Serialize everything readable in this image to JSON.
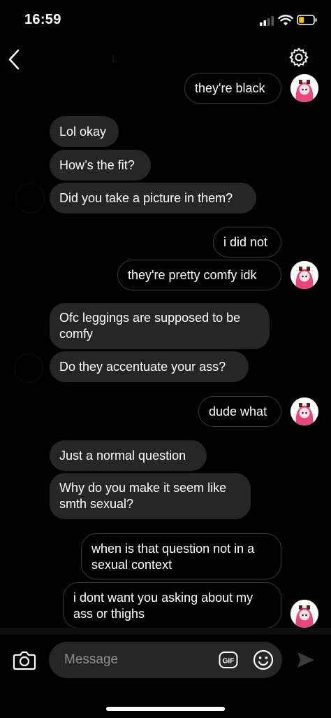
{
  "status": {
    "time": "16:59"
  },
  "header": {
    "contact_name": "L."
  },
  "messages": [
    {
      "text": "they're black",
      "from": "me"
    },
    {
      "text": "Lol okay",
      "from": "them"
    },
    {
      "text": "How’s the fit?",
      "from": "them"
    },
    {
      "text": "Did you take a picture in them?",
      "from": "them"
    },
    {
      "text": "i did not",
      "from": "me"
    },
    {
      "text": "they're pretty comfy idk",
      "from": "me"
    },
    {
      "text": "Ofc leggings are supposed to be comfy",
      "from": "them"
    },
    {
      "text": "Do they accentuate your ass?",
      "from": "them"
    },
    {
      "text": "dude what",
      "from": "me"
    },
    {
      "text": "Just a normal question",
      "from": "them"
    },
    {
      "text": "Why do you make it seem like smth sexual?",
      "from": "them"
    },
    {
      "text": "when is that question not in a sexual context",
      "from": "me"
    },
    {
      "text": "i dont want you asking about my ass or thighs",
      "from": "me"
    }
  ],
  "composer": {
    "placeholder": "Message",
    "gif_label": "GIF"
  },
  "colors": {
    "background": "#000000",
    "received_bubble": "#262626",
    "sent_bubble_border": "#3a3a3a",
    "avatar_pink": "#e8467c"
  },
  "icons": [
    "back-chevron-icon",
    "gear-icon",
    "camera-icon",
    "gif-icon",
    "emoji-icon",
    "send-icon",
    "signal-icon",
    "wifi-icon",
    "battery-icon"
  ]
}
